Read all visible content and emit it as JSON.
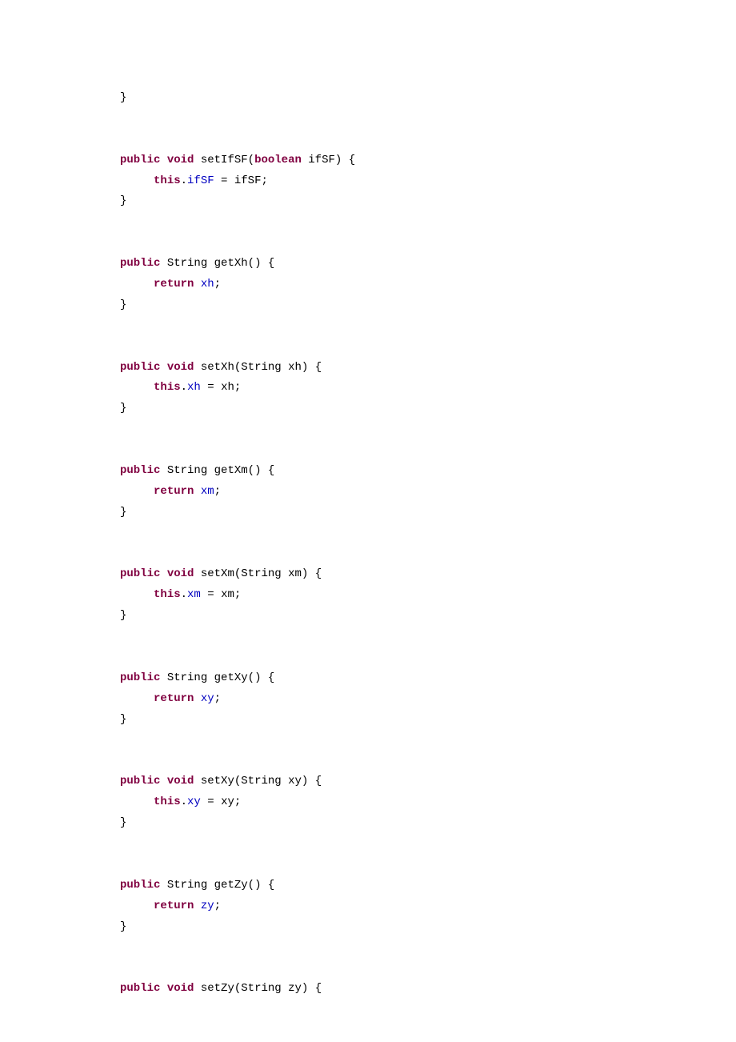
{
  "kw": {
    "public": "public",
    "void": "void",
    "return": "return",
    "this": "this",
    "boolean": "boolean"
  },
  "type": {
    "string": "String"
  },
  "methods": {
    "setIfSF": "setIfSF",
    "getXh": "getXh",
    "setXh": "setXh",
    "getXm": "getXm",
    "setXm": "setXm",
    "getXy": "getXy",
    "setXy": "setXy",
    "getZy": "getZy",
    "setZy": "setZy"
  },
  "fields": {
    "ifSF": "ifSF",
    "xh": "xh",
    "xm": "xm",
    "xy": "xy",
    "zy": "zy"
  },
  "params": {
    "ifSF": "ifSF",
    "xh": "xh",
    "xm": "xm",
    "xy": "xy",
    "zy": "zy"
  },
  "punc": {
    "lbrace": "{",
    "rbrace": "}",
    "lparen": "(",
    "rparen": ")",
    "semi": ";",
    "dot": ".",
    "eq": " = "
  }
}
